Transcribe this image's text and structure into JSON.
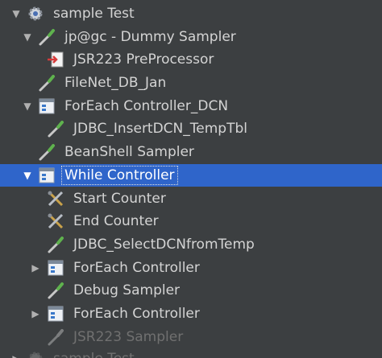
{
  "tree": {
    "rows": [
      {
        "label": "sample Test",
        "icon": "gear-icon",
        "toggle": "expanded"
      },
      {
        "label": "jp@gc - Dummy Sampler",
        "icon": "pipette-icon",
        "toggle": "expanded"
      },
      {
        "label": "JSR223 PreProcessor",
        "icon": "preprocessor-icon",
        "toggle": "none"
      },
      {
        "label": "FileNet_DB_Jan",
        "icon": "pipette-icon",
        "toggle": "none"
      },
      {
        "label": "ForEach Controller_DCN",
        "icon": "controller-icon",
        "toggle": "expanded"
      },
      {
        "label": "JDBC_InsertDCN_TempTbl",
        "icon": "pipette-icon",
        "toggle": "none"
      },
      {
        "label": "BeanShell Sampler",
        "icon": "pipette-icon",
        "toggle": "none"
      },
      {
        "label": "While Controller",
        "icon": "controller-icon",
        "toggle": "expanded",
        "selected": true
      },
      {
        "label": "Start Counter",
        "icon": "tools-icon",
        "toggle": "none"
      },
      {
        "label": "End Counter",
        "icon": "tools-icon",
        "toggle": "none"
      },
      {
        "label": "JDBC_SelectDCNfromTemp",
        "icon": "pipette-icon",
        "toggle": "none"
      },
      {
        "label": "ForEach Controller",
        "icon": "controller-icon",
        "toggle": "collapsed"
      },
      {
        "label": "Debug Sampler",
        "icon": "pipette-icon",
        "toggle": "none"
      },
      {
        "label": "ForEach Controller",
        "icon": "controller-icon",
        "toggle": "collapsed"
      },
      {
        "label": "JSR223 Sampler",
        "icon": "pipette-icon",
        "toggle": "none",
        "disabled": true
      },
      {
        "label": "sample Test",
        "icon": "gear-icon",
        "toggle": "collapsed",
        "disabled": true
      }
    ]
  },
  "colors": {
    "background": "#3c3f41",
    "selection": "#2f65ca",
    "text": "#d4d4d4",
    "disabled_text": "#707070"
  }
}
